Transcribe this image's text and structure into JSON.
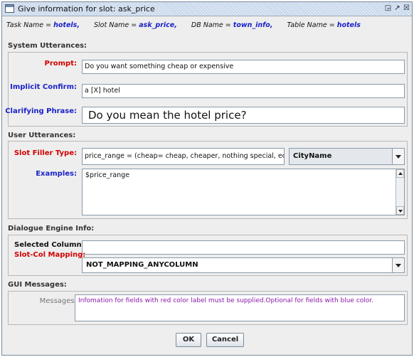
{
  "window": {
    "title": "Give information for slot: ask_price",
    "controls": {
      "restore": "◲",
      "maximize": "↗",
      "close": "☒"
    }
  },
  "info": {
    "task_key": "Task Name =",
    "task_value": "hotels,",
    "slot_key": "Slot Name =",
    "slot_value": "ask_price,",
    "db_key": "DB Name =",
    "db_value": "town_info,",
    "table_key": "Table Name =",
    "table_value": "hotels"
  },
  "system_utterances": {
    "section_label": "System Utterances:",
    "prompt_label": "Prompt:",
    "prompt_value": "Do you want something cheap or expensive",
    "implicit_label": "Implicit Confirm:",
    "implicit_value": "a [X] hotel",
    "clarifying_label": "Clarifying Phrase:",
    "clarifying_value": "Do you mean the hotel price?"
  },
  "user_utterances": {
    "section_label": "User Utterances:",
    "slot_filler_label": "Slot Filler Type:",
    "slot_filler_value": "price_range = (cheap= cheap, cheaper, nothing special, economy,",
    "slot_filler_combo": "CityName",
    "examples_label": "Examples:",
    "examples_value": "$price_range"
  },
  "dialogue_engine": {
    "section_label": "Dialogue Engine Info:",
    "selected_columns_label": "Selected Columns:",
    "selected_columns_value": "",
    "mapping_label": "Slot-Col Mapping:",
    "mapping_value": "NOT_MAPPING_ANYCOLUMN"
  },
  "gui_messages": {
    "section_label": "GUI Messages:",
    "messages_label": "Messages:",
    "messages_value": "Infomation for fields with red color label must be supplied.Optional for fields with blue color."
  },
  "buttons": {
    "ok": "OK",
    "cancel": "Cancel"
  },
  "colors": {
    "required_label": "#d10000",
    "optional_label": "#1a22c8",
    "message_text": "#8a1aa8",
    "title_bar": "#c8d8ec"
  }
}
